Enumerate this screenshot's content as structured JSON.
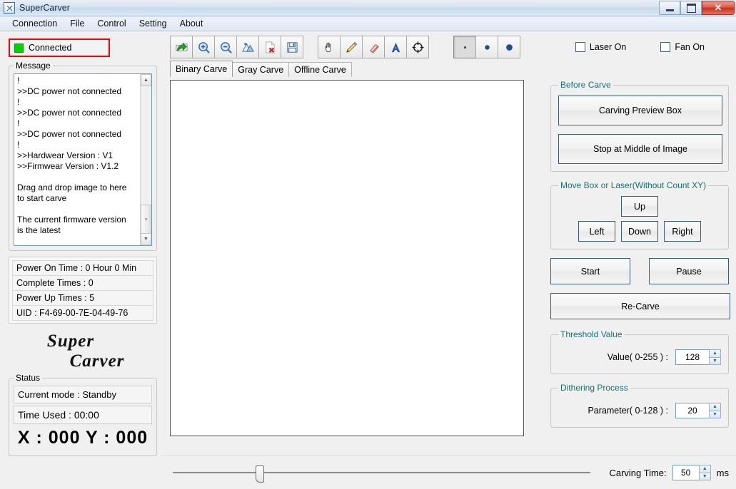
{
  "window": {
    "title": "SuperCarver",
    "icon": "app-icon",
    "buttons": {
      "minimize": "–",
      "maximize": "□",
      "close": "✕"
    }
  },
  "menubar": {
    "items": [
      "Connection",
      "File",
      "Control",
      "Setting",
      "About"
    ]
  },
  "connection": {
    "status_label": "Connected",
    "led_color": "#00d400",
    "highlight_color": "#ff0000"
  },
  "message_panel": {
    "legend": "Message",
    "text": "!\n>>DC power not connected\n!\n>>DC power not connected\n!\n>>DC power not connected\n!\n>>Hardwear Version : V1\n>>Firmwear Version : V1.2\n\nDrag and drop image to here\nto start carve\n\nThe current firmware version\nis the latest",
    "scroll_up_icon": "▲",
    "scroll_down_icon": "▼"
  },
  "stats": {
    "rows": [
      "Power On Time : 0 Hour 0 Min",
      "Complete Times : 0",
      "Power Up Times : 5",
      "UID : F4-69-00-7E-04-49-76"
    ]
  },
  "logo": {
    "line1": "Super",
    "line2": "Carver"
  },
  "status": {
    "legend": "Status",
    "current_mode": "Current mode : Standby",
    "time_used": "Time Used :  00:00",
    "coordinates": "X : 000  Y : 000"
  },
  "toolbar": {
    "group1": [
      {
        "name": "open-image-icon",
        "title": "Open"
      },
      {
        "name": "zoom-in-icon",
        "title": "Zoom In"
      },
      {
        "name": "zoom-out-icon",
        "title": "Zoom Out"
      },
      {
        "name": "image-fit-icon",
        "title": "Fit Image"
      },
      {
        "name": "delete-file-icon",
        "title": "Delete"
      },
      {
        "name": "save-icon",
        "title": "Save"
      }
    ],
    "group2": [
      {
        "name": "hand-pan-icon",
        "title": "Pan"
      },
      {
        "name": "pencil-icon",
        "title": "Draw"
      },
      {
        "name": "eraser-icon",
        "title": "Erase"
      },
      {
        "name": "text-tool-icon",
        "title": "Text"
      },
      {
        "name": "target-icon",
        "title": "Center"
      }
    ],
    "group3": [
      {
        "name": "brush-size-small-icon",
        "title": "Small",
        "selected": true
      },
      {
        "name": "brush-size-medium-icon",
        "title": "Medium",
        "selected": false
      },
      {
        "name": "brush-size-large-icon",
        "title": "Large",
        "selected": false
      }
    ],
    "checkboxes": [
      {
        "label": "Laser On",
        "checked": false
      },
      {
        "label": "Fan On",
        "checked": false
      }
    ]
  },
  "tabs": [
    {
      "label": "Binary Carve",
      "active": true
    },
    {
      "label": "Gray Carve",
      "active": false
    },
    {
      "label": "Offline Carve",
      "active": false
    }
  ],
  "before_carve": {
    "legend": "Before Carve",
    "legend_color": "#13746f",
    "preview_button": "Carving Preview Box",
    "stop_middle_button": "Stop at Middle of Image"
  },
  "move_box": {
    "legend": "Move Box or Laser(Without Count XY)",
    "up": "Up",
    "left": "Left",
    "down": "Down",
    "right": "Right"
  },
  "run_controls": {
    "start": "Start",
    "pause": "Pause",
    "recarve": "Re-Carve"
  },
  "threshold": {
    "legend": "Threshold Value",
    "label": "Value( 0-255 ) :",
    "value": "128",
    "up_icon": "▲",
    "down_icon": "▼"
  },
  "dithering": {
    "legend": "Dithering Process",
    "label": "Parameter( 0-128 ) :",
    "value": "20",
    "up_icon": "▲",
    "down_icon": "▼"
  },
  "footer": {
    "slider_position_percent": 21,
    "carving_time_label": "Carving Time:",
    "carving_time_value": "50",
    "unit": "ms"
  }
}
